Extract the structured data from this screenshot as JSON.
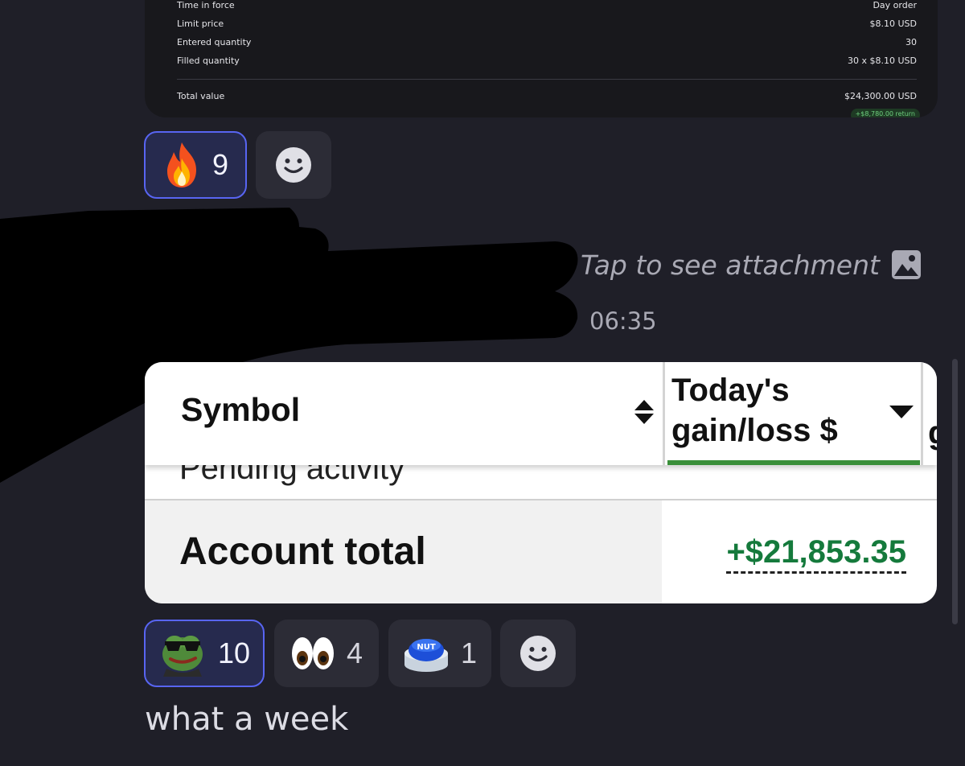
{
  "order": {
    "rows": [
      {
        "label": "Time in force",
        "value": "Day order"
      },
      {
        "label": "Limit price",
        "value": "$8.10 USD"
      },
      {
        "label": "Entered quantity",
        "value": "30"
      },
      {
        "label": "Filled quantity",
        "value": "30 x $8.10 USD"
      }
    ],
    "total_label": "Total value",
    "total_value": "$24,300.00 USD",
    "return_pill": "+$8,780.00 return"
  },
  "reactions_top": [
    {
      "icon": "fire-emoji",
      "count": "9",
      "active": true
    },
    {
      "icon": "add-reaction-icon"
    }
  ],
  "attachment": {
    "text": "Tap to see attachment",
    "icon": "image-icon"
  },
  "timestamp": "06:35",
  "brokerage": {
    "col_symbol": "Symbol",
    "col_gain_line1": "Today's",
    "col_gain_line2": "gain/loss $",
    "col_partial": "g",
    "pending_row": "Pending activity",
    "total_label": "Account total",
    "total_value": "+$21,853.35",
    "colors": {
      "gain": "#157a3c",
      "underline": "#3a8f3a"
    }
  },
  "reactions_bottom": [
    {
      "icon": "pepe-sunglasses-emoji",
      "count": "10",
      "active": true
    },
    {
      "icon": "eyes-emoji",
      "count": "4",
      "active": false
    },
    {
      "icon": "nut-button-emoji",
      "count": "1",
      "active": false,
      "label": "NUT"
    },
    {
      "icon": "add-reaction-icon"
    }
  ],
  "message": "what a week",
  "colors": {
    "background": "#1f1f28",
    "reaction_active_border": "#5865f2",
    "reaction_bg": "#2c2c36"
  }
}
